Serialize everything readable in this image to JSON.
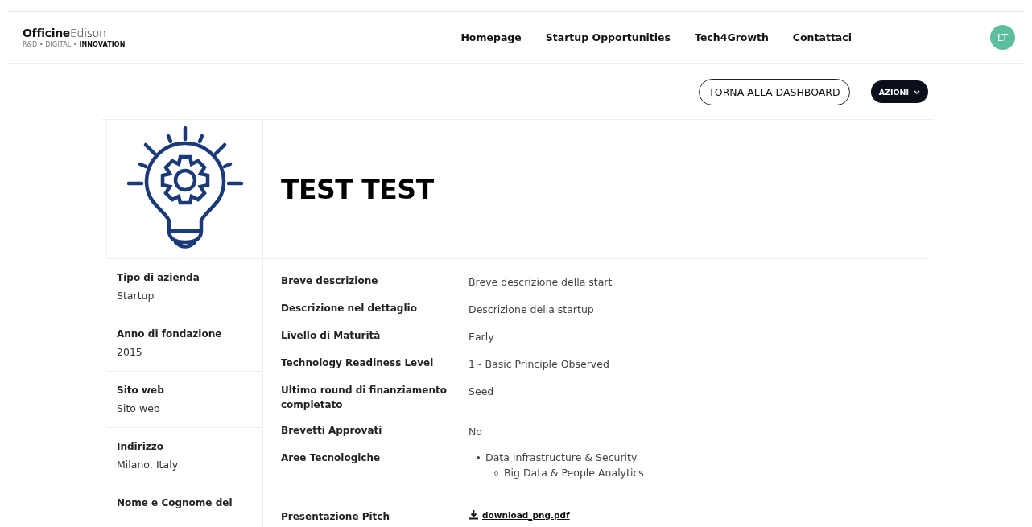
{
  "header": {
    "logo": "**Officine**Edison",
    "tagline": "R&D • DIGITAL • **INNOVATION**",
    "nav": [
      {
        "label": "Homepage"
      },
      {
        "label": "Startup Opportunities"
      },
      {
        "label": "Tech4Growth"
      },
      {
        "label": "Contattaci"
      }
    ],
    "avatar": "LT"
  },
  "actions": {
    "back": "TORNA ALLA DASHBOARD",
    "menu": "AZIONI"
  },
  "company": {
    "name": "TEST TEST",
    "side_fields": [
      {
        "label": "Tipo di azienda",
        "value": "Startup"
      },
      {
        "label": "Anno di fondazione",
        "value": "2015"
      },
      {
        "label": "Sito web",
        "value": "Sito web"
      },
      {
        "label": "Indirizzo",
        "value": "Milano, Italy"
      },
      {
        "label": "Nome e Cognome del"
      }
    ],
    "details": [
      {
        "kind": "text",
        "label": "Breve descrizione",
        "value": "Breve descrizione della start"
      },
      {
        "kind": "text",
        "label": "Descrizione nel dettaglio",
        "value": "Descrizione della startup"
      },
      {
        "kind": "text",
        "label": "Livello di Maturità",
        "value": "Early"
      },
      {
        "kind": "text",
        "label": "Technology Readiness Level",
        "value": "1 - Basic Principle Observed"
      },
      {
        "kind": "text",
        "label": "Ultimo round di finanziamento completato",
        "value": "Seed"
      },
      {
        "kind": "text",
        "label": "Brevetti Approvati",
        "value": "No"
      },
      {
        "kind": "list",
        "label": "Aree Tecnologiche",
        "items": [
          {
            "label": "Data Infrastructure & Security",
            "children": [
              {
                "label": "Big Data & People Analytics"
              }
            ]
          }
        ]
      },
      {
        "kind": "file",
        "label": "Presentazione Pitch",
        "value": "download_png.pdf"
      }
    ]
  }
}
